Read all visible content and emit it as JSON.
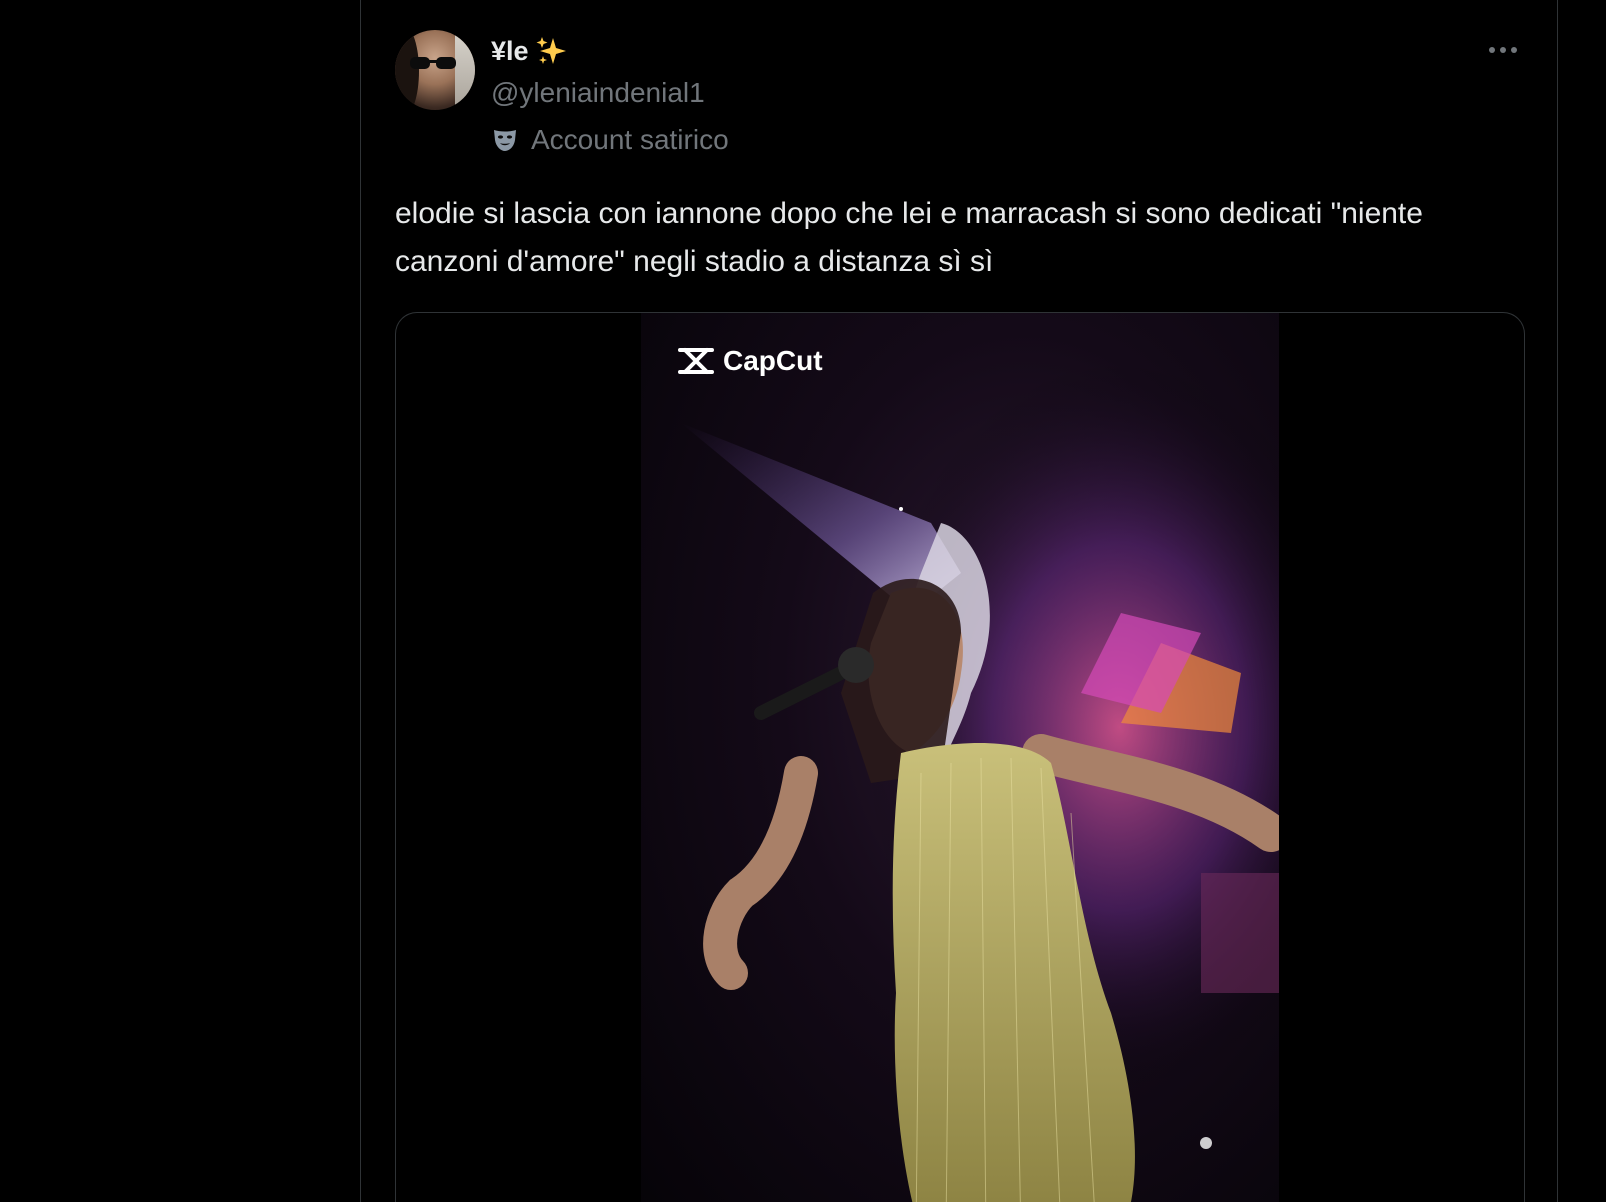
{
  "tweet": {
    "display_name": "¥le",
    "handle": "@yleniaindenial1",
    "label": "Account satirico",
    "text": "elodie si lascia con iannone dopo che lei e marracash si sono dedicati \"niente canzoni d'amore\" negli stadio a distanza sì sì",
    "more_label": "•••"
  },
  "media": {
    "type": "video",
    "watermark": "CapCut"
  },
  "colors": {
    "background": "#000000",
    "text_primary": "#e7e9ea",
    "text_secondary": "#71767b",
    "border": "#2f3336",
    "sparkle": "#ffcc4d"
  },
  "icons": {
    "badge": "sparkles-icon",
    "label": "theater-mask-icon",
    "more": "more-dots-icon"
  }
}
